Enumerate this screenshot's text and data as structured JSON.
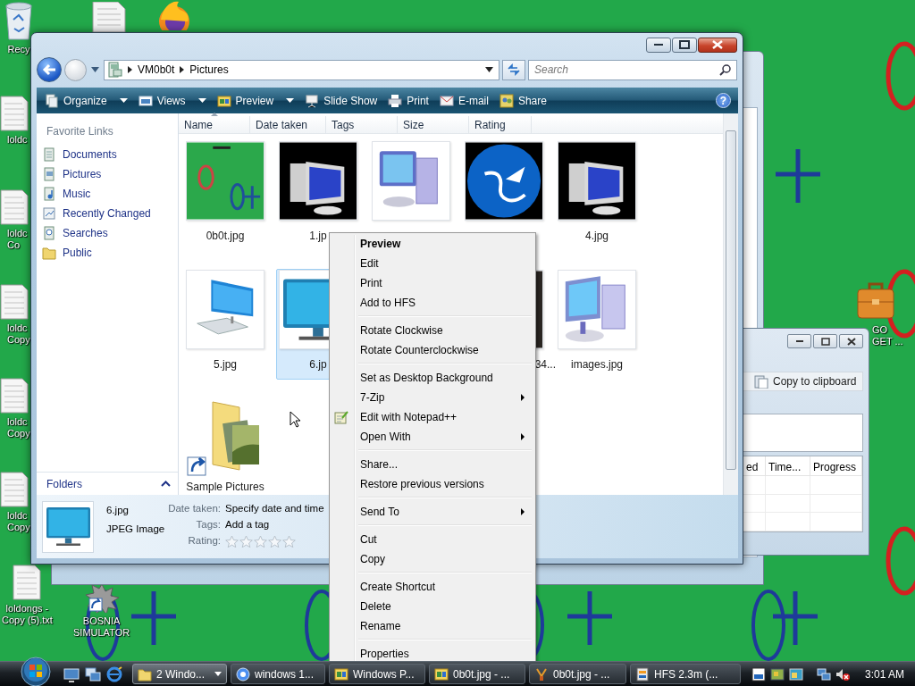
{
  "desktop": {
    "icons": [
      {
        "kind": "recycle",
        "lines": [
          "Recy"
        ]
      },
      {
        "kind": "text-file",
        "lines": [
          "loldc"
        ]
      },
      {
        "kind": "text-file",
        "lines": [
          "loldc",
          "Co"
        ]
      },
      {
        "kind": "text-file",
        "lines": [
          "loldc",
          "Copy"
        ]
      },
      {
        "kind": "text-file",
        "lines": [
          "loldc",
          "Copy"
        ]
      },
      {
        "kind": "text-file",
        "lines": [
          "loldc",
          "Copy"
        ]
      },
      {
        "kind": "text-file",
        "lines": [
          "loldongs -",
          "Copy (5).txt"
        ]
      },
      {
        "kind": "shortcut",
        "lines": [
          "BOSNIA",
          "SIMULATOR"
        ]
      },
      {
        "kind": "briefcase",
        "lines": [
          "GO",
          "GET ..."
        ]
      }
    ]
  },
  "explorer": {
    "address": {
      "crumbs": [
        "VM0b0t",
        "Pictures"
      ]
    },
    "search": {
      "placeholder": "Search"
    },
    "toolbar": [
      {
        "label": "Organize",
        "dropdown": true
      },
      {
        "label": "Views",
        "dropdown": true
      },
      {
        "label": "Preview",
        "dropdown": true
      },
      {
        "label": "Slide Show",
        "dropdown": false
      },
      {
        "label": "Print",
        "dropdown": false
      },
      {
        "label": "E-mail",
        "dropdown": false
      },
      {
        "label": "Share",
        "dropdown": false
      }
    ],
    "help": "?",
    "nav": {
      "header": "Favorite Links",
      "links": [
        "Documents",
        "Pictures",
        "Music",
        "Recently Changed",
        "Searches",
        "Public"
      ],
      "folders": "Folders"
    },
    "columns": [
      {
        "label": "Name",
        "sorted": true
      },
      {
        "label": "Date taken",
        "sorted": false
      },
      {
        "label": "Tags",
        "sorted": false
      },
      {
        "label": "Size",
        "sorted": false
      },
      {
        "label": "Rating",
        "sorted": false
      }
    ],
    "files": [
      {
        "label": "0b0t.jpg",
        "kind": "picture",
        "selected": false
      },
      {
        "label": "1.jp",
        "kind": "picture",
        "selected": false
      },
      {
        "kind": "picture",
        "selected": false
      },
      {
        "kind": "picture",
        "selected": false
      },
      {
        "label": "4.jpg",
        "kind": "picture",
        "selected": false
      },
      {
        "label": "5.jpg",
        "kind": "picture",
        "selected": false
      },
      {
        "label": "6.jp",
        "kind": "picture",
        "selected": true
      },
      {
        "label": "34...",
        "kind": "picture",
        "selected": false,
        "label_cut": true
      },
      {
        "label": "images.jpg",
        "kind": "picture",
        "selected": false
      },
      {
        "label": "Sample Pictures",
        "kind": "folder",
        "selected": false
      }
    ],
    "details": {
      "name": "6.jpg",
      "type": "JPEG Image",
      "fields": [
        {
          "label": "Date taken:",
          "value": "Specify date and time"
        },
        {
          "label": "Tags:",
          "value": "Add a tag"
        }
      ],
      "rating": {
        "label": "Rating:",
        "stars": 0
      }
    }
  },
  "context_menu": {
    "groups": [
      {
        "items": [
          {
            "label": "Preview",
            "kind": "plain",
            "default": true
          },
          {
            "label": "Edit",
            "kind": "plain",
            "default": false
          },
          {
            "label": "Print",
            "kind": "plain",
            "default": false
          },
          {
            "label": "Add to HFS",
            "kind": "plain",
            "default": false
          }
        ]
      },
      {
        "items": [
          {
            "label": "Rotate Clockwise",
            "kind": "plain",
            "default": false
          },
          {
            "label": "Rotate Counterclockwise",
            "kind": "plain",
            "default": false
          }
        ]
      },
      {
        "items": [
          {
            "label": "Set as Desktop Background",
            "kind": "plain",
            "default": false
          },
          {
            "label": "7-Zip",
            "kind": "submenu",
            "default": false
          },
          {
            "label": "Edit with Notepad++",
            "kind": "icon",
            "default": false
          },
          {
            "label": "Open With",
            "kind": "submenu",
            "default": false
          }
        ]
      },
      {
        "items": [
          {
            "label": "Share...",
            "kind": "plain",
            "default": false
          },
          {
            "label": "Restore previous versions",
            "kind": "plain",
            "default": false
          }
        ]
      },
      {
        "items": [
          {
            "label": "Send To",
            "kind": "submenu",
            "default": false
          }
        ]
      },
      {
        "items": [
          {
            "label": "Cut",
            "kind": "plain",
            "default": false
          },
          {
            "label": "Copy",
            "kind": "plain",
            "default": false
          }
        ]
      },
      {
        "items": [
          {
            "label": "Create Shortcut",
            "kind": "plain",
            "default": false
          },
          {
            "label": "Delete",
            "kind": "plain",
            "default": false
          },
          {
            "label": "Rename",
            "kind": "plain",
            "default": false
          }
        ]
      },
      {
        "items": [
          {
            "label": "Properties",
            "kind": "plain",
            "default": false
          }
        ]
      }
    ]
  },
  "hfs_window": {
    "copy_button": "Copy to clipboard",
    "columns": [
      "ed",
      "Time...",
      "Progress"
    ]
  },
  "taskbar": {
    "tasks": [
      {
        "label": "2 Windo...",
        "selected": true,
        "grouped": true
      },
      {
        "label": "windows 1...",
        "selected": false,
        "grouped": false
      },
      {
        "label": "Windows P...",
        "selected": false,
        "grouped": false
      },
      {
        "label": "0b0t.jpg - ...",
        "selected": false,
        "grouped": false
      },
      {
        "label": "0b0t.jpg - ...",
        "selected": false,
        "grouped": false
      },
      {
        "label": "HFS 2.3m (...",
        "selected": false,
        "grouped": false
      }
    ],
    "clock": "3:01 AM"
  }
}
